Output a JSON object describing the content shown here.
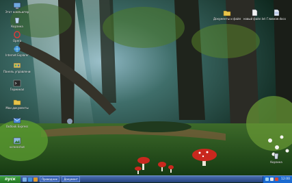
{
  "desktop": {
    "left_icons": [
      {
        "label": "Этот компьютер",
        "icon": "computer-icon",
        "color": "#6fa8e0"
      },
      {
        "label": "Корзина",
        "icon": "recycle-bin-icon",
        "color": "#b8d4ee"
      },
      {
        "label": "Opera",
        "icon": "browser-icon",
        "color": "#d23c3c"
      },
      {
        "label": "Internet Explorer",
        "icon": "globe-icon",
        "color": "#3d8fd8"
      },
      {
        "label": "Панель управления",
        "icon": "control-panel-icon",
        "color": "#d0b85a"
      },
      {
        "label": "Терминал",
        "icon": "terminal-icon",
        "color": "#2a2a2a"
      },
      {
        "label": "Мои документы",
        "icon": "folder-icon",
        "color": "#e8c44a"
      },
      {
        "label": "Outlook Express",
        "icon": "mail-icon",
        "color": "#4f8fdc"
      },
      {
        "label": "screenshot",
        "icon": "image-icon",
        "color": "#8fb8e0"
      }
    ],
    "right_icons": [
      {
        "label": "Документы и файлы",
        "icon": "folder-icon",
        "color": "#e8c44a"
      },
      {
        "label": "новый файл.txt",
        "icon": "text-file-icon",
        "color": "#f2f2f2"
      },
      {
        "label": "Главная.docx",
        "icon": "document-icon",
        "color": "#e9eef8"
      }
    ],
    "corner_icon": {
      "label": "Корзина",
      "icon": "recycle-bin-icon",
      "color": "#cfd8e2"
    }
  },
  "taskbar": {
    "start_label": "пуск",
    "tasks": [
      "Проводник",
      "Документ"
    ],
    "clock": "12:00",
    "colors": {
      "bar": "#2f5aa8",
      "start": "#2e8b2e",
      "tray": "#1b6ad0"
    }
  }
}
